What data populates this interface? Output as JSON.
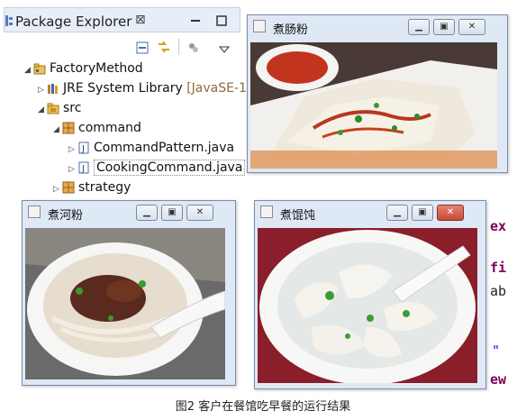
{
  "explorer": {
    "title": "Package Explorer",
    "close_glyph": "⊠",
    "tree": [
      {
        "label": "FactoryMethod",
        "icon": "project-icon"
      },
      {
        "label": "JRE System Library",
        "suffix": "[JavaSE-1.",
        "icon": "library-icon"
      },
      {
        "label": "src",
        "icon": "source-folder-icon"
      },
      {
        "label": "command",
        "icon": "package-icon"
      },
      {
        "label": "CommandPattern.java",
        "icon": "java-file-icon"
      },
      {
        "label": "CookingCommand.java",
        "icon": "java-file-icon"
      },
      {
        "label": "strategy",
        "icon": "package-icon"
      }
    ]
  },
  "windows": {
    "changfen": {
      "title": "煮肠粉"
    },
    "hefen": {
      "title": "煮河粉"
    },
    "huntun": {
      "title": "煮馄饨"
    }
  },
  "code_fragments": [
    "ex",
    "fi",
    "ab",
    "\"",
    "ew"
  ],
  "caption": "图2 客户在餐馆吃早餐的运行结果",
  "colors": {
    "accent": "#7f0055",
    "window_frame": "#dfe9f5",
    "close_red": "#c44a37"
  }
}
